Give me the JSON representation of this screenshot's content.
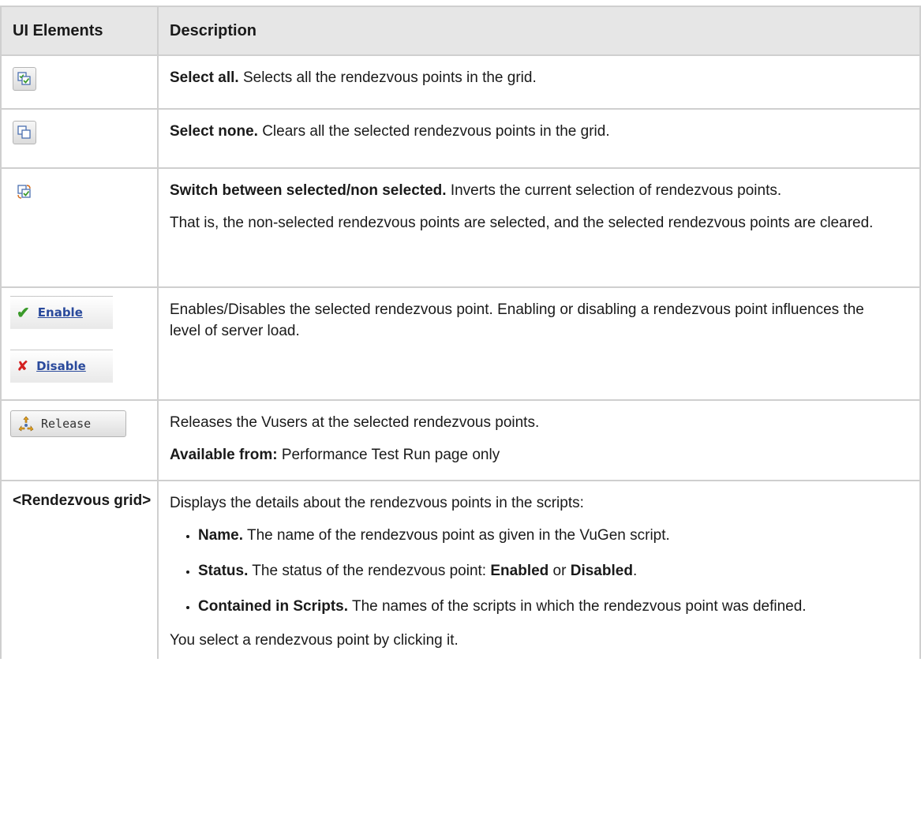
{
  "table": {
    "headers": [
      "UI Elements",
      "Description"
    ],
    "rows": {
      "select_all": {
        "icon": "select-all-icon",
        "title": "Select all.",
        "text": " Selects all the rendezvous points in the grid."
      },
      "select_none": {
        "icon": "select-none-icon",
        "title": "Select none.",
        "text": " Clears all the selected rendezvous points in the grid."
      },
      "switch": {
        "icon": "invert-selection-icon",
        "title": "Switch between selected/non selected.",
        "text": " Inverts the current selection of rendezvous points.",
        "text2": "That is, the non-selected rendezvous points are selected, and the selected rendezvous points are cleared."
      },
      "enable_disable": {
        "enable_label": "Enable",
        "disable_label": "Disable",
        "text": "Enables/Disables the selected rendezvous point. Enabling or disabling a rendezvous point influences the level of server load."
      },
      "release": {
        "button_label": "Release",
        "text": "Releases the Vusers at the selected rendezvous points.",
        "available_label": "Available from:",
        "available_text": " Performance Test Run page only"
      },
      "grid": {
        "label": "<Rendezvous grid>",
        "intro": "Displays the details about the rendezvous points in the scripts:",
        "bullets": {
          "name": {
            "title": "Name.",
            "text": " The name of the rendezvous point as given in the VuGen script."
          },
          "status": {
            "title": "Status.",
            "text": " The status of the rendezvous point: ",
            "enabled": "Enabled",
            "or": " or ",
            "disabled": "Disabled",
            "end": "."
          },
          "scripts": {
            "title": "Contained in Scripts.",
            "text": " The names of the scripts in which the rendezvous point was defined."
          }
        },
        "footer": "You select a rendezvous point by clicking it."
      }
    }
  },
  "colors": {
    "header_bg": "#e6e6e6",
    "border": "#cfcfcf",
    "link_blue": "#2a4a9c",
    "check_green": "#3a9a2a",
    "x_red": "#d42020"
  }
}
